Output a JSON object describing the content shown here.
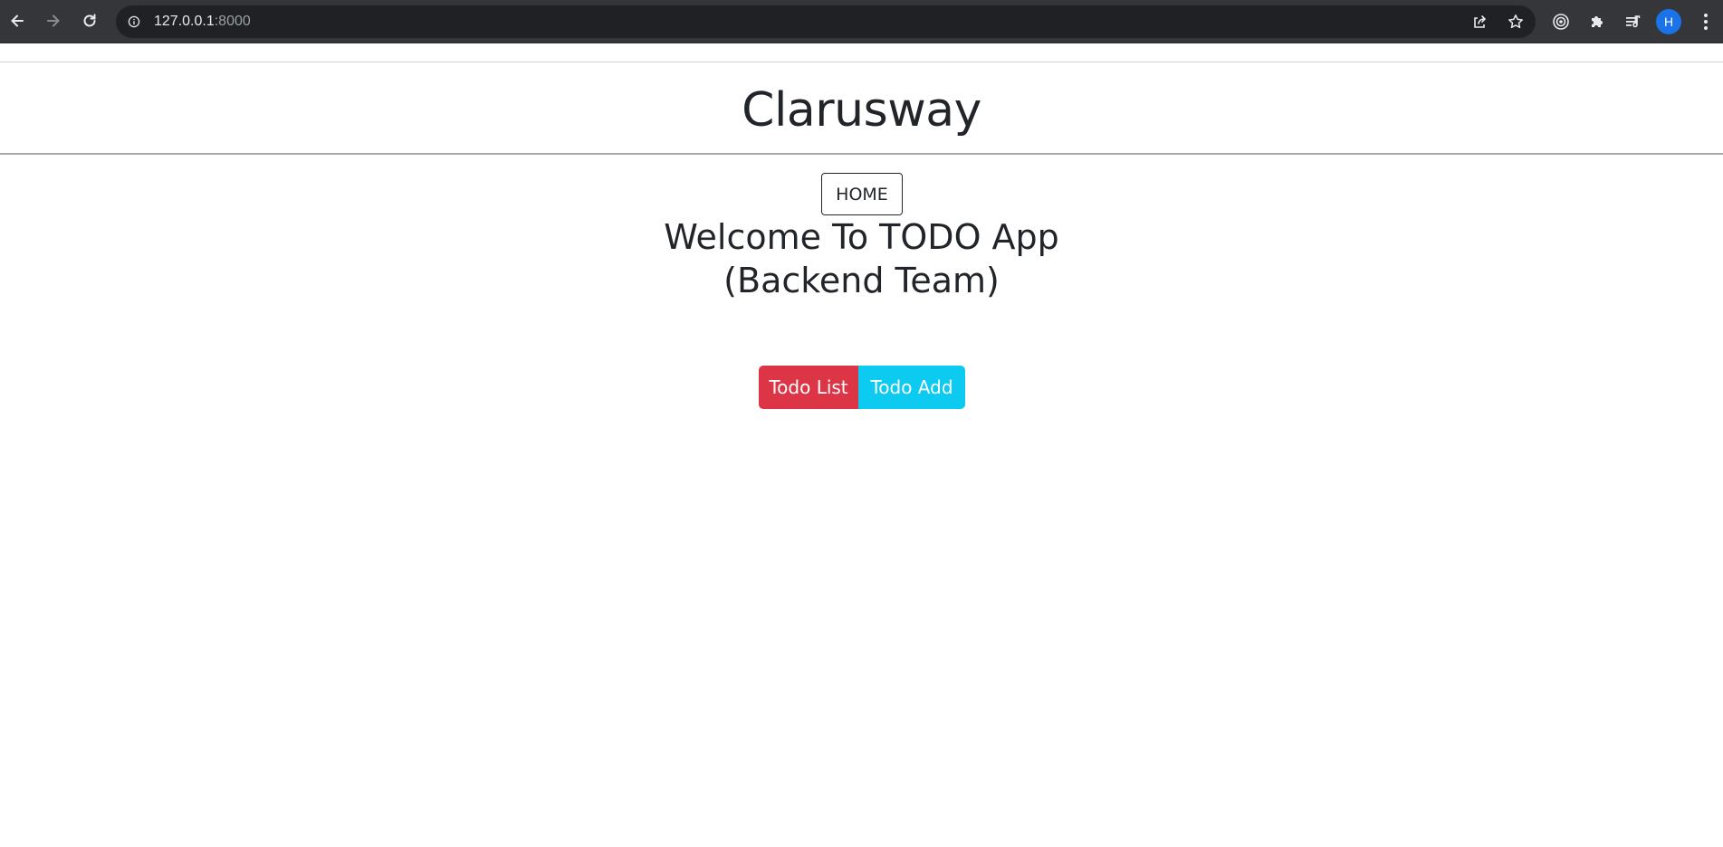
{
  "browser": {
    "url_host": "127.0.0.1",
    "url_port": ":8000",
    "profile_initial": "H",
    "colors": {
      "toolbar": "#35363a",
      "omnibox": "#202124",
      "avatar": "#1a73e8"
    },
    "icons": [
      "back-arrow-icon",
      "forward-arrow-icon",
      "reload-icon",
      "info-icon",
      "share-icon",
      "star-icon",
      "extension-target-icon",
      "puzzle-icon",
      "media-queue-icon",
      "menu-dots-icon"
    ]
  },
  "page": {
    "brand": "Clarusway",
    "home_label": "HOME",
    "welcome_line1": "Welcome To TODO App",
    "welcome_line2": "(Backend Team)",
    "buttons": {
      "todo_list": "Todo List",
      "todo_add": "Todo Add"
    },
    "colors": {
      "danger": "#dc3545",
      "info": "#0dcaf0",
      "text": "#212529"
    }
  }
}
